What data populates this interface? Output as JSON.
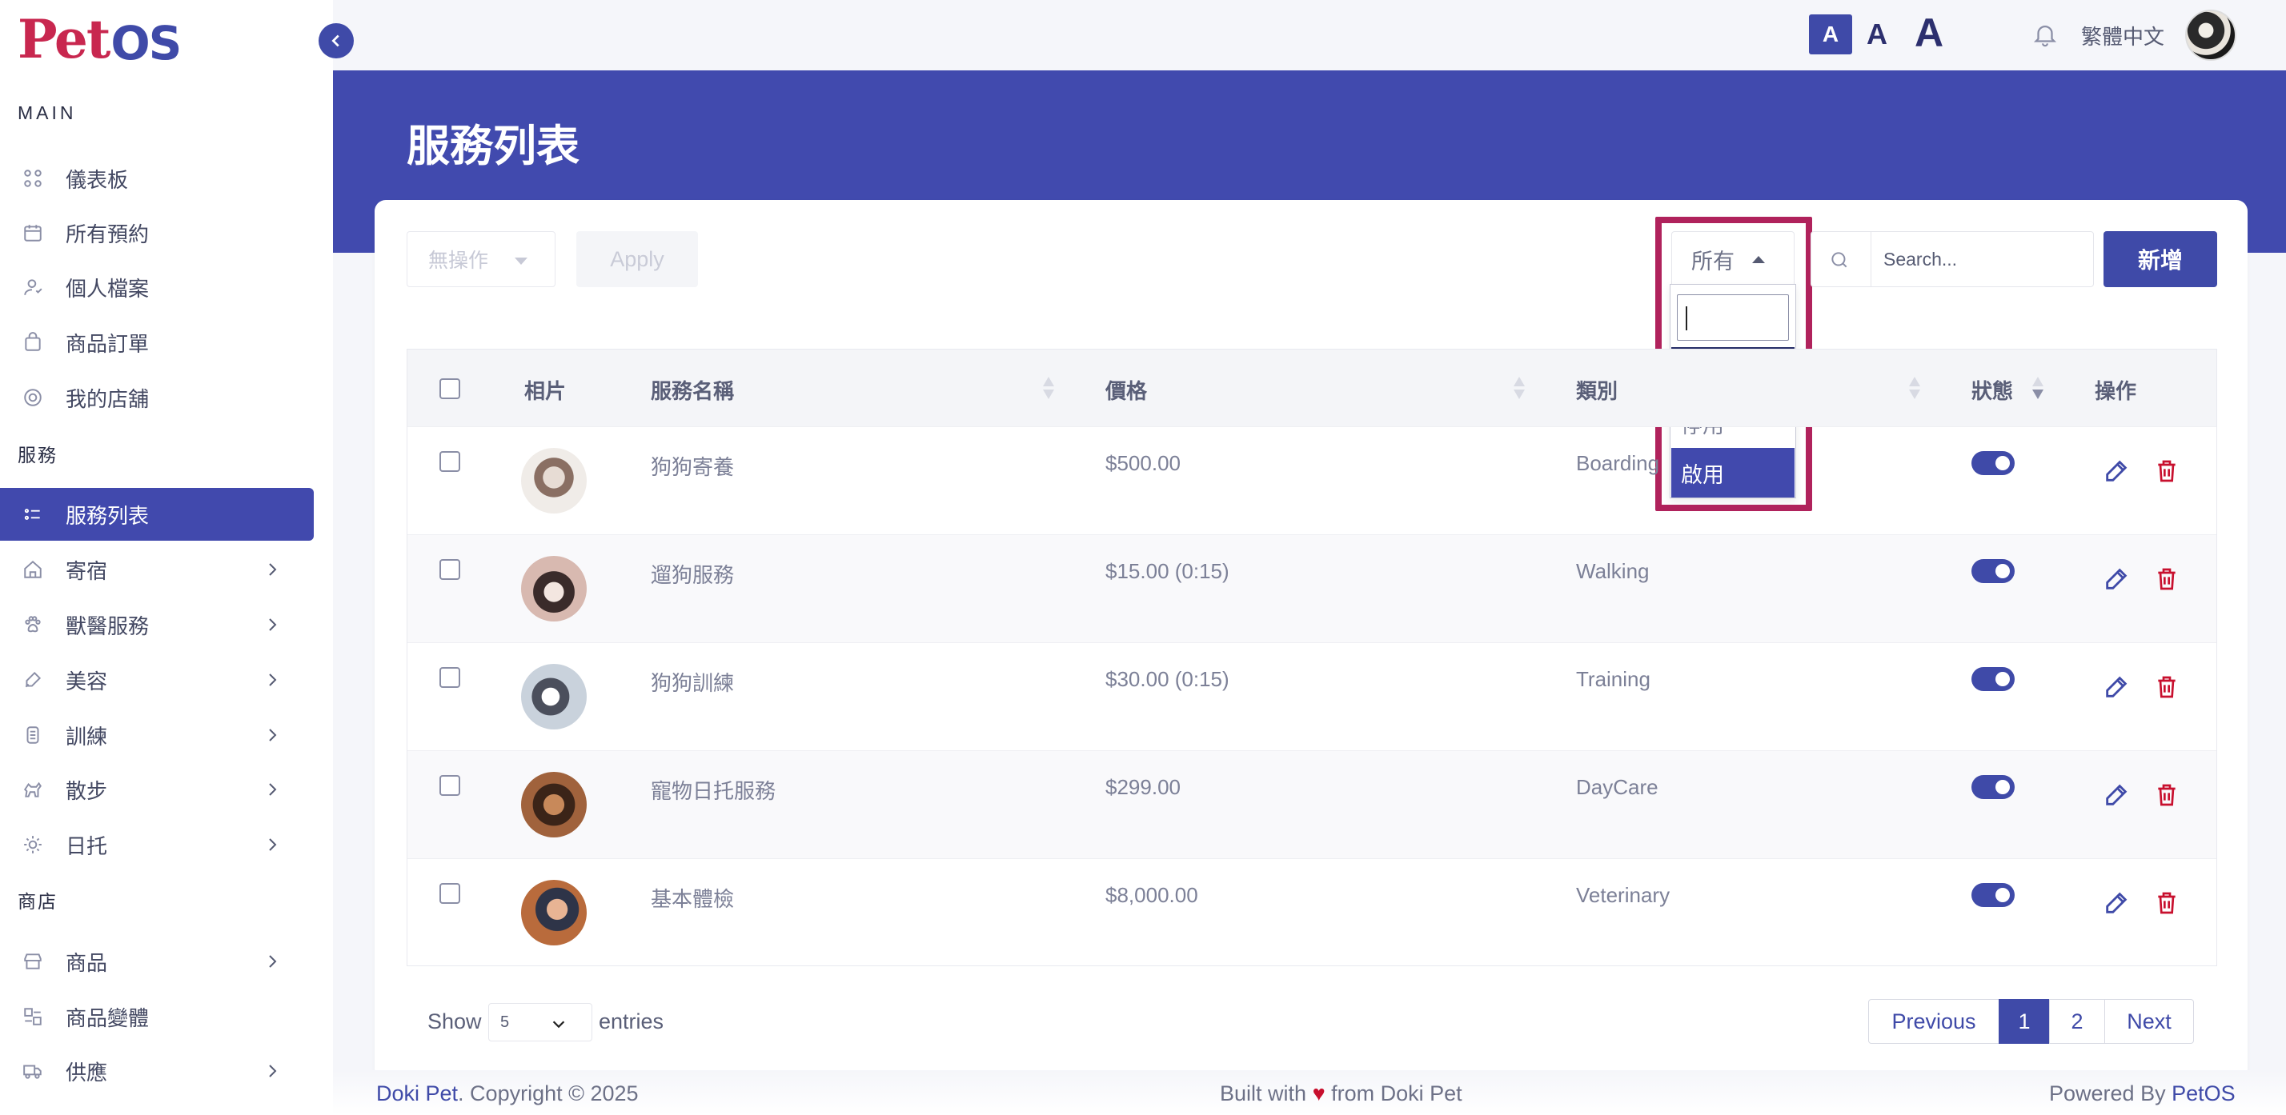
{
  "brand": {
    "logo_pet": "Pet",
    "logo_os": "OS"
  },
  "sidebar": {
    "sections": {
      "main": "MAIN",
      "services": "服務",
      "shop": "商店"
    },
    "items": [
      {
        "label": "儀表板",
        "icon": "grid-icon"
      },
      {
        "label": "所有預約",
        "icon": "calendar-icon"
      },
      {
        "label": "個人檔案",
        "icon": "user-icon"
      },
      {
        "label": "商品訂單",
        "icon": "bag-icon"
      },
      {
        "label": "我的店舖",
        "icon": "store-icon"
      },
      {
        "label": "服務列表",
        "icon": "list-icon",
        "active": true
      },
      {
        "label": "寄宿",
        "icon": "house-icon"
      },
      {
        "label": "獸醫服務",
        "icon": "paw-icon"
      },
      {
        "label": "美容",
        "icon": "brush-icon"
      },
      {
        "label": "訓練",
        "icon": "medal-icon"
      },
      {
        "label": "散步",
        "icon": "dog-icon"
      },
      {
        "label": "日托",
        "icon": "sun-icon"
      },
      {
        "label": "商品",
        "icon": "shop-icon"
      },
      {
        "label": "商品變體",
        "icon": "variants-icon"
      },
      {
        "label": "供應",
        "icon": "truck-icon"
      }
    ]
  },
  "topbar": {
    "font_sizes": [
      "A",
      "A",
      "A"
    ],
    "language": "繁體中文"
  },
  "page": {
    "title": "服務列表"
  },
  "toolbar": {
    "bulk_action": "無操作",
    "apply": "Apply",
    "status_filter": "所有",
    "status_options": [
      "所有",
      "停用",
      "啟用"
    ],
    "search_placeholder": "Search...",
    "add": "新增"
  },
  "table": {
    "headers": {
      "photo": "相片",
      "name": "服務名稱",
      "price": "價格",
      "category": "類別",
      "status": "狀態",
      "actions": "操作"
    },
    "rows": [
      {
        "name": "狗狗寄養",
        "price": "$500.00",
        "category": "Boarding",
        "enabled": true
      },
      {
        "name": "遛狗服務",
        "price": "$15.00 (0:15)",
        "category": "Walking",
        "enabled": true
      },
      {
        "name": "狗狗訓練",
        "price": "$30.00 (0:15)",
        "category": "Training",
        "enabled": true
      },
      {
        "name": "寵物日托服務",
        "price": "$299.00",
        "category": "DayCare",
        "enabled": true
      },
      {
        "name": "基本體檢",
        "price": "$8,000.00",
        "category": "Veterinary",
        "enabled": true
      }
    ]
  },
  "pagination": {
    "show": "Show",
    "entries_value": "5",
    "entries": "entries",
    "previous": "Previous",
    "pages": [
      "1",
      "2"
    ],
    "next": "Next"
  },
  "footer": {
    "left_brand": "Doki Pet",
    "left_text": ". Copyright © 2025",
    "center_before": "Built with",
    "center_after": "from Doki Pet",
    "right_text": "Powered By",
    "right_brand": "PetOS"
  },
  "colors": {
    "primary": "#3f4aa8",
    "banner": "#414aae",
    "highlight": "#b0225c",
    "danger": "#c8102e"
  }
}
